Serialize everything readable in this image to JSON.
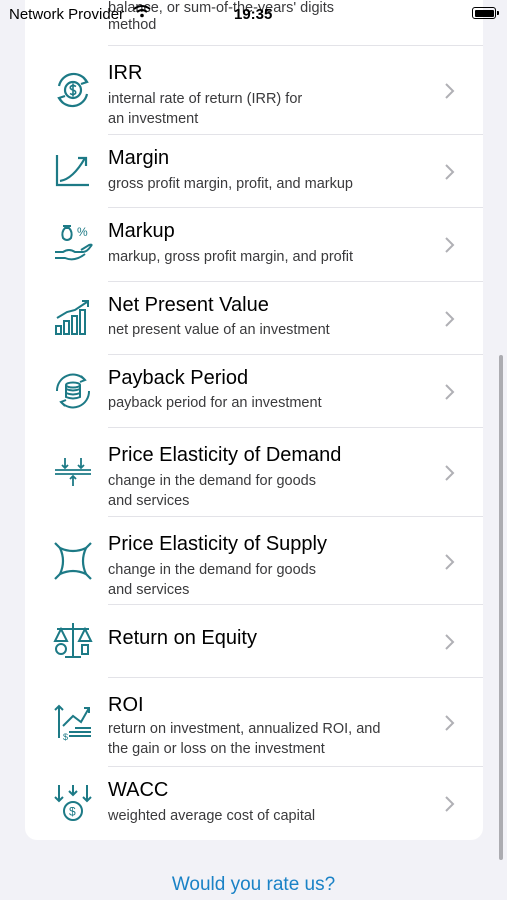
{
  "status_bar": {
    "carrier": "Network Provider",
    "time": "19:35"
  },
  "list": {
    "partial_item": {
      "subtitle_line1": "balance, or sum-of-the-years' digits",
      "subtitle_line2": "method"
    },
    "items": [
      {
        "title": "IRR",
        "subtitle1": "internal rate of return (IRR) for",
        "subtitle2": "an investment",
        "icon": "irr-dollar-cycle-icon"
      },
      {
        "title": "Margin",
        "subtitle1": "gross profit margin, profit, and markup",
        "icon": "growth-chart-icon"
      },
      {
        "title": "Markup",
        "subtitle1": "markup, gross profit margin, and profit",
        "icon": "money-hand-percent-icon"
      },
      {
        "title": "Net Present Value",
        "subtitle1": "net present value of an investment",
        "icon": "bar-chart-growth-icon"
      },
      {
        "title": "Payback Period",
        "subtitle1": "payback period for an investment",
        "icon": "coins-cycle-icon"
      },
      {
        "title": "Price Elasticity of Demand",
        "subtitle1": "change in the demand for goods",
        "subtitle2": "and services",
        "icon": "compress-arrows-icon"
      },
      {
        "title": "Price Elasticity of Supply",
        "subtitle1": "change in the demand for goods",
        "subtitle2": "and services",
        "icon": "elastic-square-icon"
      },
      {
        "title": "Return on Equity",
        "icon": "balance-scale-icon"
      },
      {
        "title": "ROI",
        "subtitle1": "return on investment, annualized ROI, and",
        "subtitle2": "the gain or loss on the investment",
        "icon": "roi-arrows-icon"
      },
      {
        "title": "WACC",
        "subtitle1": "weighted average cost of capital",
        "icon": "wacc-arrows-icon"
      }
    ]
  },
  "footer": {
    "rate_label": "Would you rate us?"
  },
  "colors": {
    "icon": "#1d7a86",
    "link": "#1a82c6"
  }
}
